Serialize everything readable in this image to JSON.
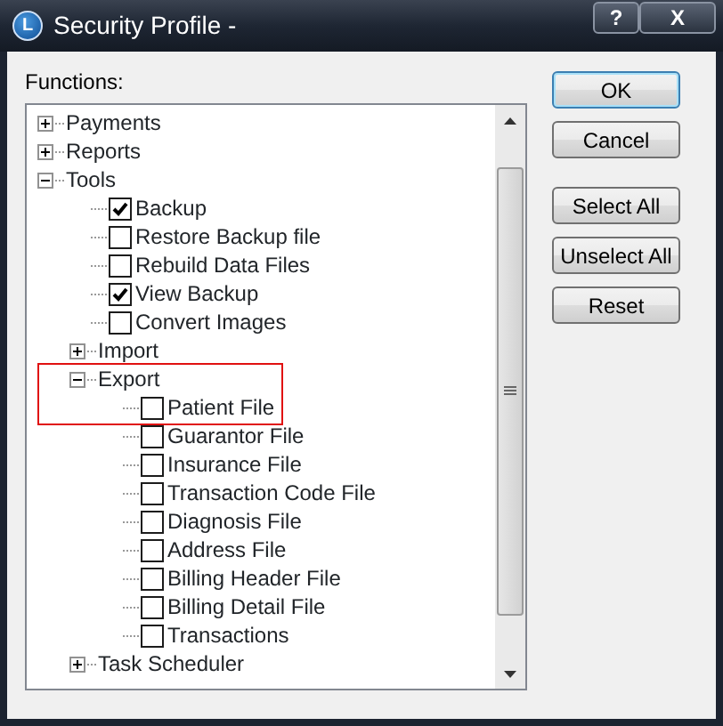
{
  "window": {
    "title": "Security Profile -",
    "icon_letter": "L",
    "help_button": "?",
    "close_button": "X"
  },
  "functions_label": "Functions:",
  "tree": [
    {
      "kind": "folder",
      "label": "Payments",
      "expanded": false
    },
    {
      "kind": "folder",
      "label": "Reports",
      "expanded": false
    },
    {
      "kind": "folder",
      "label": "Tools",
      "expanded": true,
      "children": [
        {
          "kind": "check",
          "label": "Backup",
          "checked": true
        },
        {
          "kind": "check",
          "label": "Restore Backup file",
          "checked": false
        },
        {
          "kind": "check",
          "label": "Rebuild Data Files",
          "checked": false
        },
        {
          "kind": "check",
          "label": "View Backup",
          "checked": true
        },
        {
          "kind": "check",
          "label": "Convert Images",
          "checked": false
        },
        {
          "kind": "folder",
          "label": "Import",
          "expanded": false
        },
        {
          "kind": "folder",
          "label": "Export",
          "expanded": true,
          "highlighted": true,
          "children": [
            {
              "kind": "check",
              "label": "Patient File",
              "checked": false,
              "highlighted": true
            },
            {
              "kind": "check",
              "label": "Guarantor File",
              "checked": false
            },
            {
              "kind": "check",
              "label": "Insurance File",
              "checked": false
            },
            {
              "kind": "check",
              "label": "Transaction Code File",
              "checked": false
            },
            {
              "kind": "check",
              "label": "Diagnosis File",
              "checked": false
            },
            {
              "kind": "check",
              "label": "Address File",
              "checked": false
            },
            {
              "kind": "check",
              "label": "Billing Header File",
              "checked": false
            },
            {
              "kind": "check",
              "label": "Billing Detail File",
              "checked": false
            },
            {
              "kind": "check",
              "label": "Transactions",
              "checked": false
            }
          ]
        },
        {
          "kind": "folder",
          "label": "Task Scheduler",
          "expanded": false
        }
      ]
    }
  ],
  "buttons": [
    {
      "label": "OK",
      "default": true
    },
    {
      "label": "Cancel",
      "default": false
    },
    {
      "label": "Select All",
      "default": false
    },
    {
      "label": "Unselect All",
      "default": false
    },
    {
      "label": "Reset",
      "default": false
    }
  ]
}
